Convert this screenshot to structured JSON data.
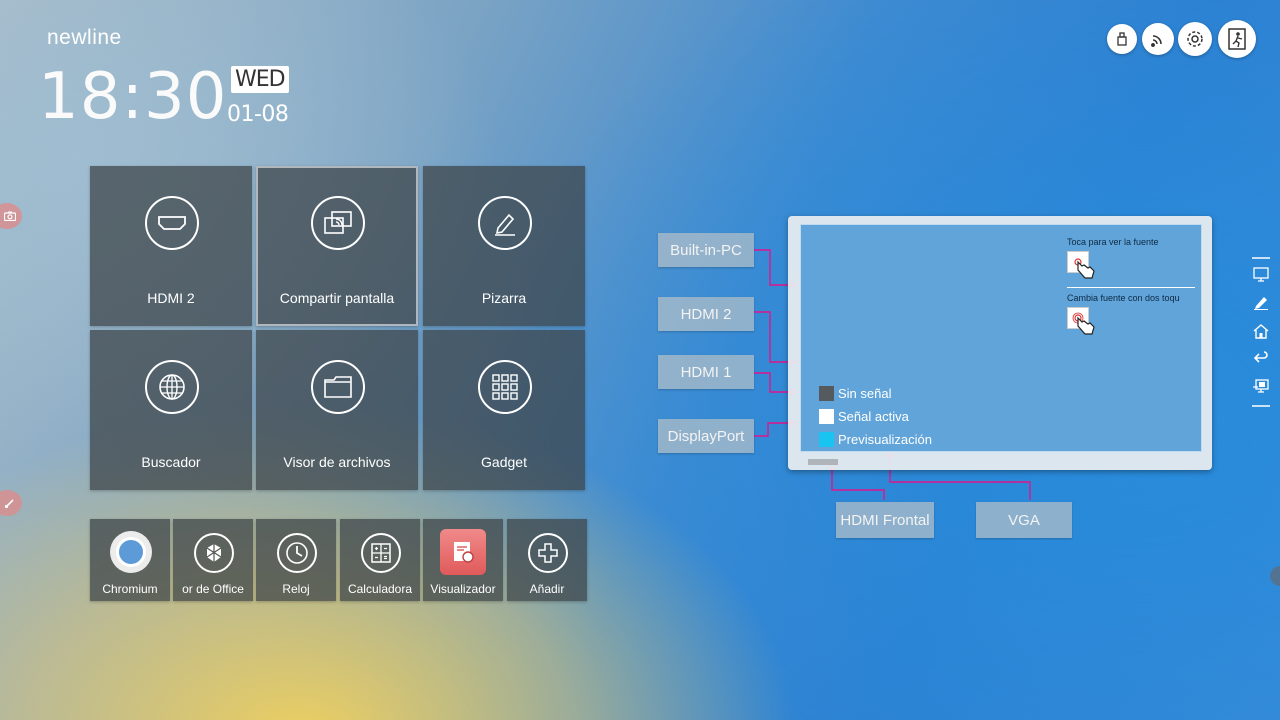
{
  "brand": "newline",
  "clock": {
    "time": "18:30",
    "day": "WED",
    "date": "01-08"
  },
  "tiles": [
    {
      "label": "HDMI 2",
      "icon": "hdmi-icon"
    },
    {
      "label": "Compartir pantalla",
      "icon": "screen-share-icon"
    },
    {
      "label": "Pizarra",
      "icon": "pen-icon"
    },
    {
      "label": "Buscador",
      "icon": "globe-icon"
    },
    {
      "label": "Visor de archivos",
      "icon": "folder-icon"
    },
    {
      "label": "Gadget",
      "icon": "grid-icon"
    }
  ],
  "apps": [
    {
      "label": "Chromium",
      "icon": "chromium-icon"
    },
    {
      "label": "or de Office",
      "icon": "office-icon"
    },
    {
      "label": "Reloj",
      "icon": "clock-icon"
    },
    {
      "label": "Calculadora",
      "icon": "calculator-icon"
    },
    {
      "label": "Visualizador",
      "icon": "viewer-icon"
    },
    {
      "label": "Añadir",
      "icon": "plus-icon"
    }
  ],
  "top_buttons": [
    "usb-icon",
    "wifi-icon",
    "gear-icon",
    "exit-icon"
  ],
  "sources": {
    "builtin_pc": "Built-in-PC",
    "hdmi2": "HDMI 2",
    "hdmi1": "HDMI 1",
    "displayport": "DisplayPort",
    "hdmi_frontal": "HDMI Frontal",
    "vga": "VGA"
  },
  "monitor": {
    "hint_touch": "Toca para ver la fuente",
    "hint_change": "Cambia fuente con dos toqu",
    "legend": [
      {
        "label": "Sin señal",
        "color": "#555a5e"
      },
      {
        "label": "Señal activa",
        "color": "#ffffff"
      },
      {
        "label": "Previsualización",
        "color": "#19c4f0"
      }
    ]
  },
  "colors": {
    "accent": "#e0148c",
    "tile_bg": "#3c4246"
  }
}
